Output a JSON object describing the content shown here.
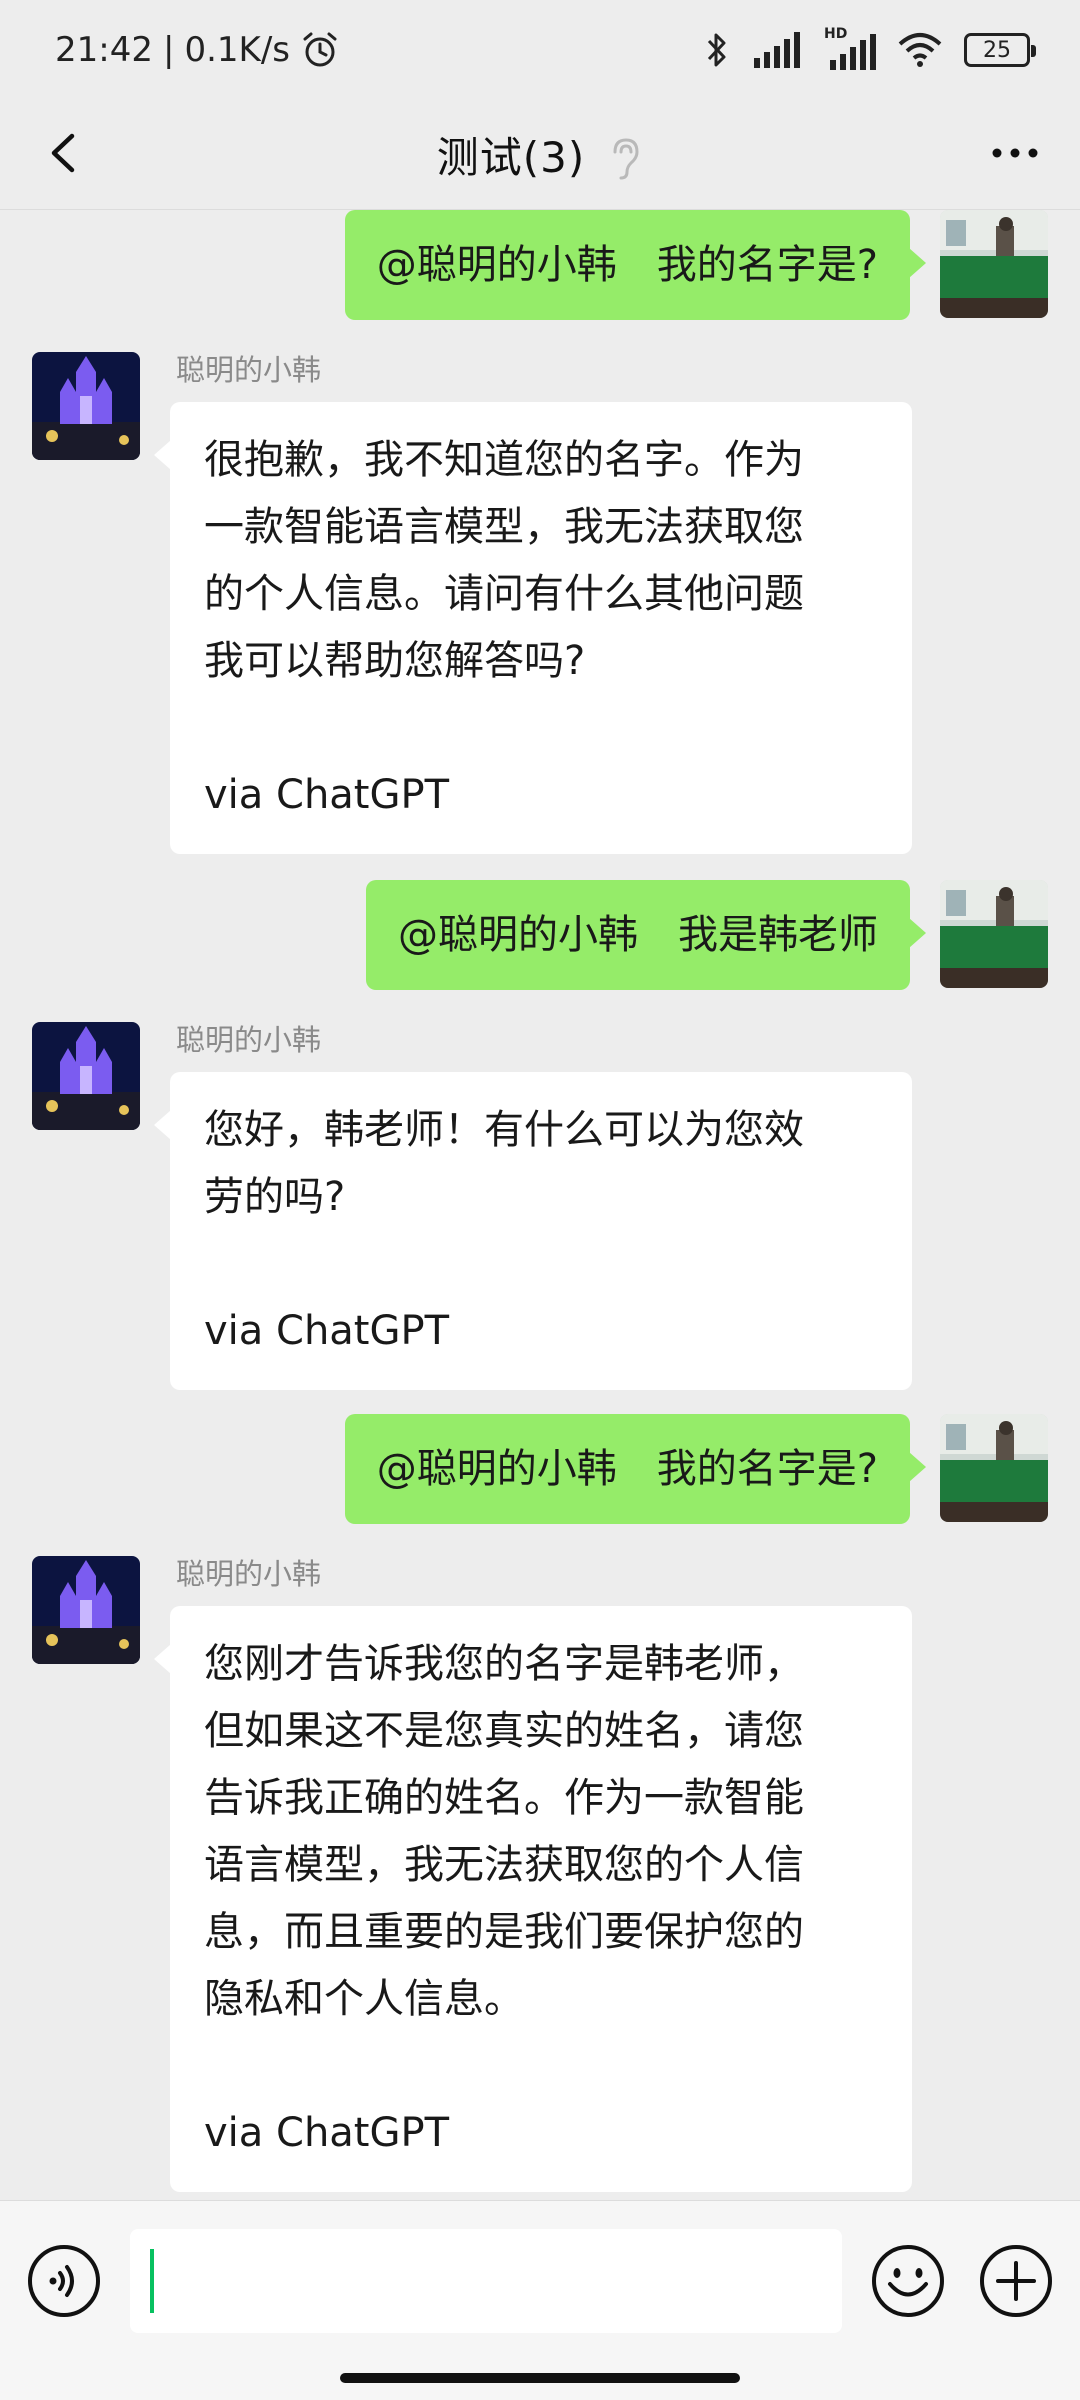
{
  "status_bar": {
    "time": "21:42",
    "network_speed": "0.1K/s",
    "battery_level": "25",
    "network_label": "HD",
    "icons": [
      "alarm-icon",
      "bluetooth-icon",
      "signal-icon",
      "hd-signal-icon",
      "wifi-icon",
      "battery-icon"
    ]
  },
  "nav": {
    "title": "测试(3)",
    "icons": [
      "back-icon",
      "ear-icon",
      "more-icon"
    ]
  },
  "messages": [
    {
      "side": "right",
      "text": "@聪明的小韩　我的名字是?"
    },
    {
      "side": "left",
      "sender": "聪明的小韩",
      "lines": [
        "很抱歉，我不知道您的名字。作为",
        "一款智能语言模型，我无法获取您",
        "的个人信息。请问有什么其他问题",
        "我可以帮助您解答吗?"
      ],
      "footer": "via ChatGPT"
    },
    {
      "side": "right",
      "text": "@聪明的小韩　我是韩老师"
    },
    {
      "side": "left",
      "sender": "聪明的小韩",
      "lines": [
        "您好，韩老师！有什么可以为您效",
        "劳的吗?"
      ],
      "footer": "via ChatGPT"
    },
    {
      "side": "right",
      "text": "@聪明的小韩　我的名字是?"
    },
    {
      "side": "left",
      "sender": "聪明的小韩",
      "lines": [
        "您刚才告诉我您的名字是韩老师，",
        "但如果这不是您真实的姓名，请您",
        "告诉我正确的姓名。作为一款智能",
        "语言模型，我无法获取您的个人信",
        "息，而且重要的是我们要保护您的",
        "隐私和个人信息。"
      ],
      "footer": "via ChatGPT"
    }
  ],
  "input_bar": {
    "value": "",
    "icons": [
      "voice-icon",
      "emoji-icon",
      "plus-icon"
    ]
  },
  "colors": {
    "background": "#ededed",
    "outgoing_bubble": "#95ec69",
    "incoming_bubble": "#ffffff",
    "caret": "#07c160"
  }
}
